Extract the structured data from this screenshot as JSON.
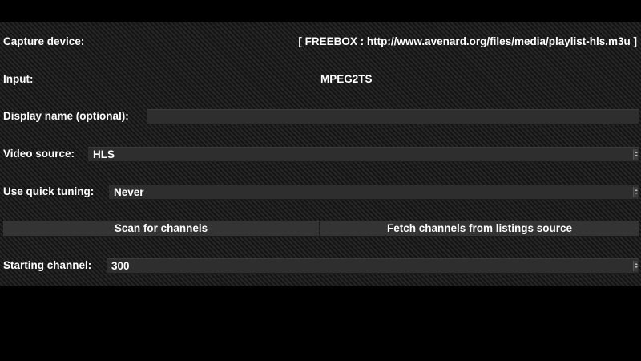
{
  "capture_device": {
    "label": "Capture device:",
    "value": "[ FREEBOX : http://www.avenard.org/files/media/playlist-hls.m3u ]"
  },
  "input": {
    "label": "Input:",
    "value": "MPEG2TS"
  },
  "display_name": {
    "label": "Display name (optional):",
    "value": ""
  },
  "video_source": {
    "label": "Video source:",
    "value": "HLS"
  },
  "quick_tuning": {
    "label": "Use quick tuning:",
    "value": "Never"
  },
  "buttons": {
    "scan": "Scan for channels",
    "fetch": "Fetch channels from listings source"
  },
  "starting_channel": {
    "label": "Starting channel:",
    "value": "300"
  }
}
